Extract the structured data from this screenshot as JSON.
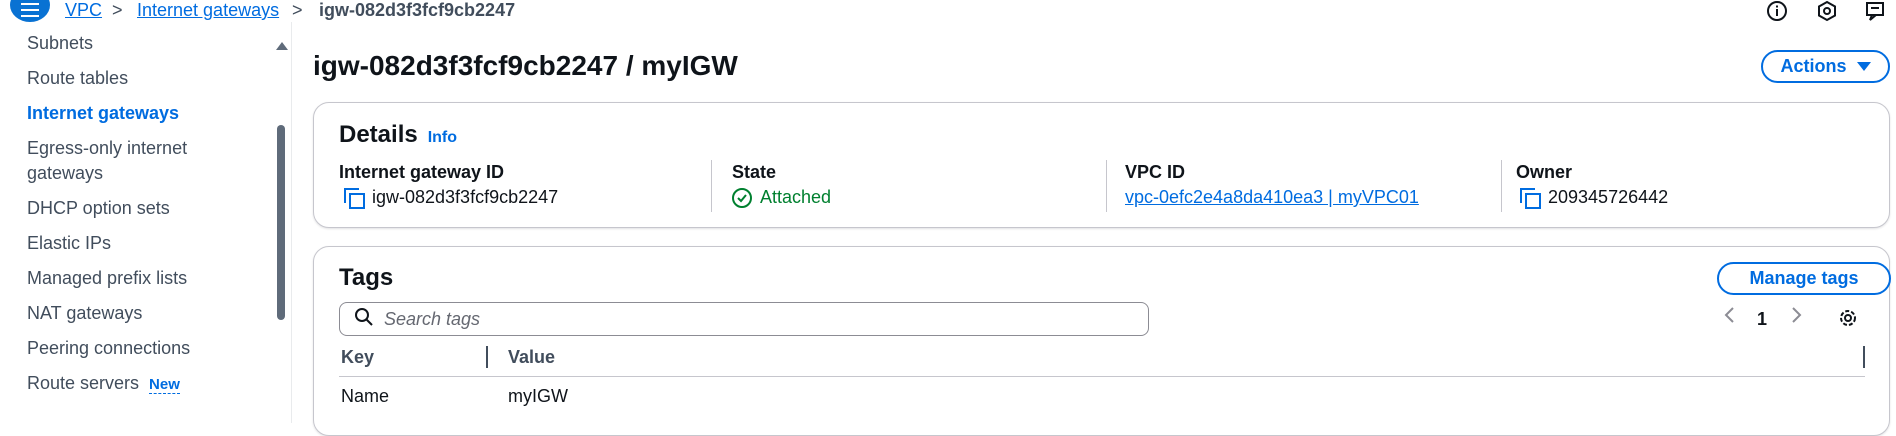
{
  "breadcrumb": {
    "items": [
      "VPC",
      "Internet gateways"
    ],
    "separator": ">",
    "current": "igw-082d3f3fcf9cb2247"
  },
  "top_icons": [
    "info-circle-icon",
    "settings-hex-icon",
    "feedback-icon"
  ],
  "sidebar": {
    "items": [
      {
        "label": "Subnets"
      },
      {
        "label": "Route tables"
      },
      {
        "label": "Internet gateways",
        "active": true
      },
      {
        "label": "Egress-only internet"
      },
      {
        "label": "gateways"
      },
      {
        "label": "DHCP option sets"
      },
      {
        "label": "Elastic IPs"
      },
      {
        "label": "Managed prefix lists"
      },
      {
        "label": "NAT gateways"
      },
      {
        "label": "Peering connections"
      },
      {
        "label": "Route servers",
        "badge": "New"
      }
    ]
  },
  "page": {
    "title": "igw-082d3f3fcf9cb2247 / myIGW",
    "actions_label": "Actions"
  },
  "details": {
    "title": "Details",
    "info_label": "Info",
    "fields": [
      {
        "label": "Internet gateway ID",
        "value": "igw-082d3f3fcf9cb2247"
      },
      {
        "label": "State",
        "value": "Attached"
      },
      {
        "label": "VPC ID",
        "value": "vpc-0efc2e4a8da410ea3 | myVPC01"
      },
      {
        "label": "Owner",
        "value": "209345726442"
      }
    ]
  },
  "tags": {
    "title": "Tags",
    "manage_label": "Manage tags",
    "search_placeholder": "Search tags",
    "page_number": "1",
    "columns": [
      "Key",
      "Value"
    ],
    "rows": [
      {
        "key": "Name",
        "value": "myIGW"
      }
    ]
  },
  "colors": {
    "accent": "#006ce0",
    "success": "#00802f",
    "menu_button": "#0972d3"
  }
}
